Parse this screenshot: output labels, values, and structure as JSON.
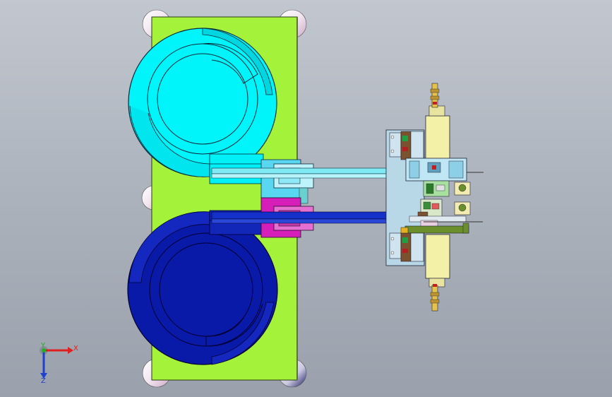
{
  "scene": {
    "colors": {
      "background_top": "#c2c7cf",
      "background_bottom": "#9aa1ac",
      "base_plate": "#a4f23a",
      "upper_bowl": "#00f5fa",
      "lower_bowl": "#0a1aa8",
      "upper_track_block": "#5ad7f0",
      "lower_track_block": "#d51fb8",
      "cylinder_body": "#f3f0a8",
      "mount_plate": "#b8d8e8",
      "valve_brown": "#7a5230",
      "green_bracket": "#6b8f2a"
    },
    "components": {
      "base_plate": "base-plate",
      "upper_vibratory_bowl": "upper-vibratory-bowl",
      "lower_vibratory_bowl": "lower-vibratory-bowl",
      "upper_linear_feeder": "upper-linear-feeder",
      "lower_linear_feeder": "lower-linear-feeder",
      "pneumatic_station": "pneumatic-station"
    }
  },
  "triad": {
    "x_label": "X",
    "y_label": "Y",
    "z_label": "Z",
    "x_color": "#e02020",
    "y_color": "#20b020",
    "z_color": "#2040d0"
  }
}
